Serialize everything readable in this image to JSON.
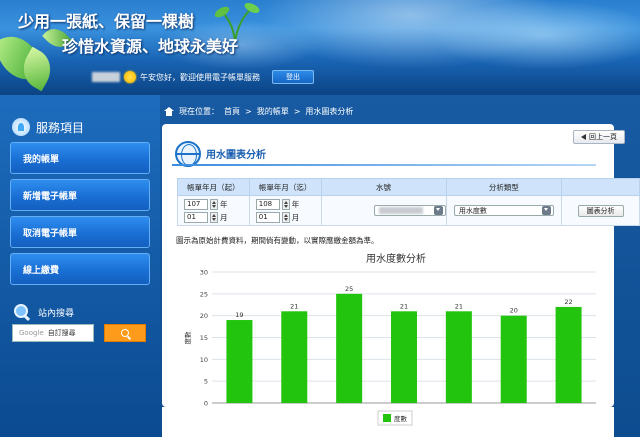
{
  "banner": {
    "slogan_line1": "少用一張紙、保留一棵樹",
    "slogan_line2": "珍惜水資源、地球永美好"
  },
  "user": {
    "greeting": "午安您好，歡迎使用電子帳單服務",
    "logout_label": "登出"
  },
  "sidebar": {
    "title": "服務項目",
    "items": [
      {
        "label": "我的帳單"
      },
      {
        "label": "新增電子帳單"
      },
      {
        "label": "取消電子帳單"
      },
      {
        "label": "線上繳費"
      }
    ],
    "search_title": "站內搜尋",
    "search_google": "Google",
    "search_placeholder": "自訂搜尋"
  },
  "breadcrumb": {
    "prefix": "現在位置：",
    "items": [
      "首頁",
      "我的帳單",
      "用水圖表分析"
    ],
    "sep": ">"
  },
  "page": {
    "back_label": "回上一頁",
    "title": "用水圖表分析",
    "note": "圖示為原始計費資料，期間倘有變動，以實際應繳金額為準。"
  },
  "form": {
    "headers": [
      "帳單年月（起）",
      "帳單年月（迄）",
      "水號",
      "分析類型",
      ""
    ],
    "start_year": "107",
    "start_month": "01",
    "end_year": "108",
    "end_month": "01",
    "year_unit": "年",
    "month_unit": "月",
    "analysis_type": "用水度數",
    "query_label": "圖表分析"
  },
  "chart_data": {
    "type": "bar",
    "title": "用水度數分析",
    "ylabel": "度數",
    "xlabel": "",
    "categories": [
      "",
      "",
      "",
      "",
      "",
      "",
      ""
    ],
    "series": [
      {
        "name": "度數",
        "values": [
          19,
          21,
          25,
          21,
          21,
          20,
          22
        ]
      }
    ],
    "ylim": [
      0,
      30
    ],
    "yticks": [
      0,
      5,
      10,
      15,
      20,
      25,
      30
    ],
    "grid": true,
    "legend": "bottom-center",
    "bar_color": "#22c40e"
  }
}
